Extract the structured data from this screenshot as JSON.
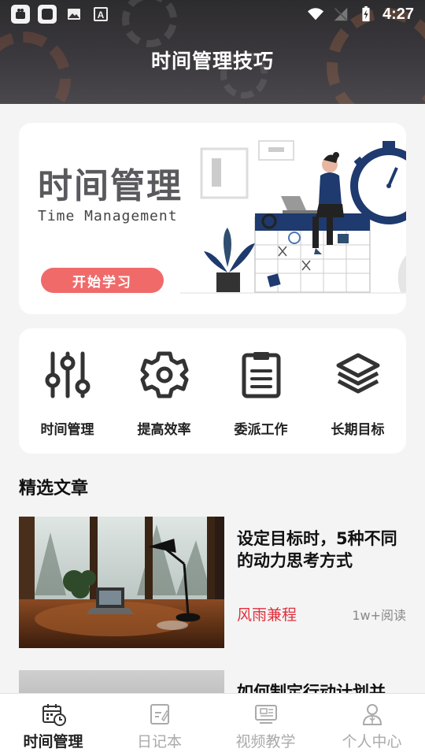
{
  "status_bar": {
    "time": "4:27"
  },
  "header": {
    "title": "时间管理技巧"
  },
  "banner": {
    "title": "时间管理",
    "subtitle": "Time Management",
    "button_label": "开始学习"
  },
  "quick_menu": [
    {
      "label": "时间管理",
      "icon": "sliders-icon"
    },
    {
      "label": "提高效率",
      "icon": "gear-icon"
    },
    {
      "label": "委派工作",
      "icon": "clipboard-icon"
    },
    {
      "label": "长期目标",
      "icon": "layers-icon"
    }
  ],
  "section": {
    "title": "精选文章"
  },
  "articles": [
    {
      "title": "设定目标时，5种不同的动力思考方式",
      "author": "风雨兼程",
      "reads": "1w+阅读"
    },
    {
      "title": "如何制定行动计划并",
      "author": "",
      "reads": ""
    }
  ],
  "bottom_nav": [
    {
      "label": "时间管理",
      "icon": "calendar-clock-icon",
      "active": true
    },
    {
      "label": "日记本",
      "icon": "notebook-icon",
      "active": false
    },
    {
      "label": "视频教学",
      "icon": "monitor-icon",
      "active": false
    },
    {
      "label": "个人中心",
      "icon": "person-icon",
      "active": false
    }
  ],
  "colors": {
    "accent": "#e0303c",
    "button": "#f06a6a",
    "header": "#333236"
  }
}
